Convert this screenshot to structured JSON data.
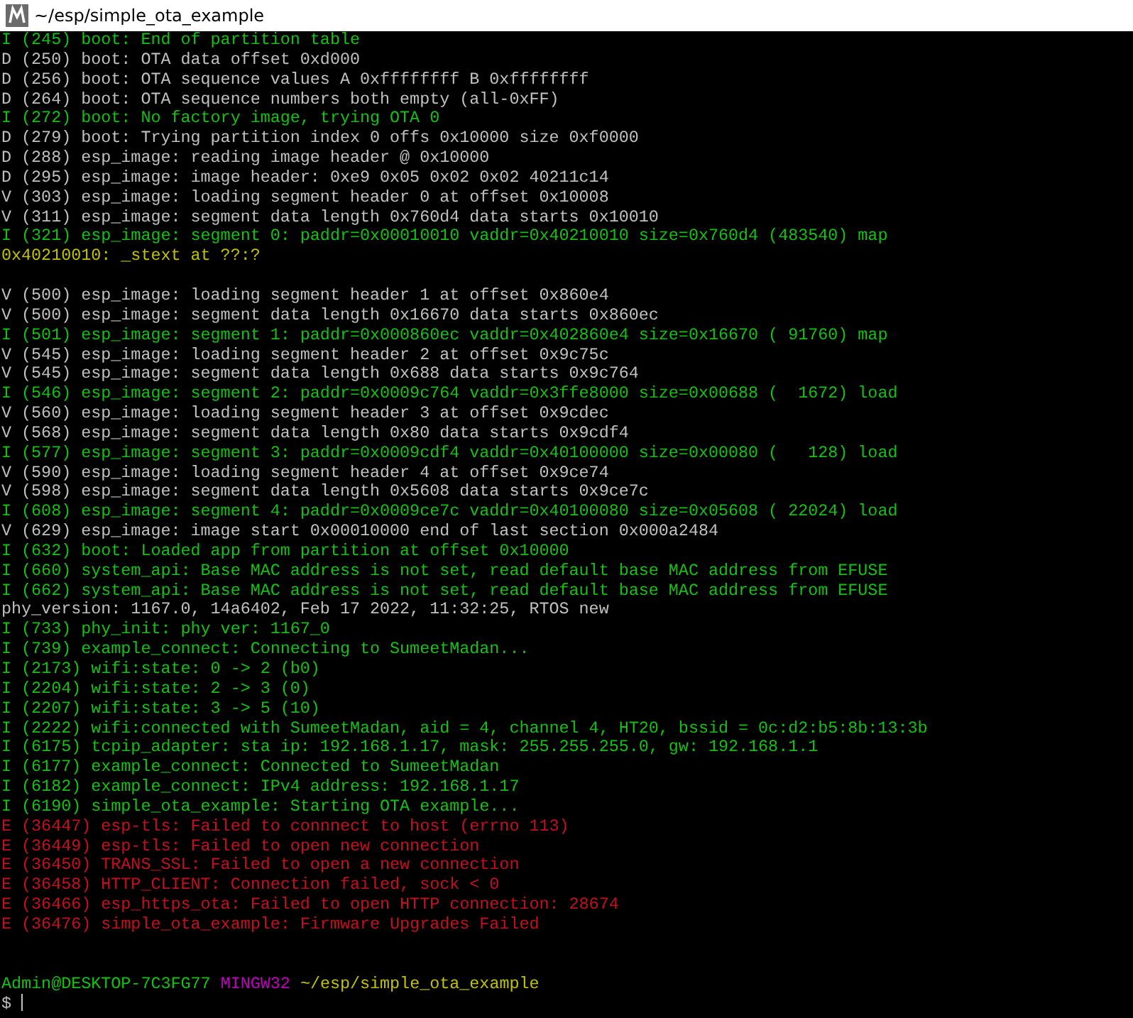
{
  "window": {
    "title": "~/esp/simple_ota_example"
  },
  "lines": [
    {
      "kind": "info",
      "text": "I (245) boot: End of partition table"
    },
    {
      "kind": "debug",
      "text": "D (250) boot: OTA data offset 0xd000"
    },
    {
      "kind": "debug",
      "text": "D (256) boot: OTA sequence values A 0xffffffff B 0xffffffff"
    },
    {
      "kind": "debug",
      "text": "D (264) boot: OTA sequence numbers both empty (all-0xFF)"
    },
    {
      "kind": "info",
      "text": "I (272) boot: No factory image, trying OTA 0"
    },
    {
      "kind": "debug",
      "text": "D (279) boot: Trying partition index 0 offs 0x10000 size 0xf0000"
    },
    {
      "kind": "debug",
      "text": "D (288) esp_image: reading image header @ 0x10000"
    },
    {
      "kind": "debug",
      "text": "D (295) esp_image: image header: 0xe9 0x05 0x02 0x02 40211c14"
    },
    {
      "kind": "verbose",
      "text": "V (303) esp_image: loading segment header 0 at offset 0x10008"
    },
    {
      "kind": "verbose",
      "text": "V (311) esp_image: segment data length 0x760d4 data starts 0x10010"
    },
    {
      "kind": "info",
      "text": "I (321) esp_image: segment 0: paddr=0x00010010 vaddr=0x40210010 size=0x760d4 (483540) map"
    },
    {
      "kind": "address",
      "text": "0x40210010: _stext at ??:?"
    },
    {
      "kind": "blank"
    },
    {
      "kind": "verbose",
      "text": "V (500) esp_image: loading segment header 1 at offset 0x860e4"
    },
    {
      "kind": "verbose",
      "text": "V (500) esp_image: segment data length 0x16670 data starts 0x860ec"
    },
    {
      "kind": "info",
      "text": "I (501) esp_image: segment 1: paddr=0x000860ec vaddr=0x402860e4 size=0x16670 ( 91760) map"
    },
    {
      "kind": "verbose",
      "text": "V (545) esp_image: loading segment header 2 at offset 0x9c75c"
    },
    {
      "kind": "verbose",
      "text": "V (545) esp_image: segment data length 0x688 data starts 0x9c764"
    },
    {
      "kind": "info",
      "text": "I (546) esp_image: segment 2: paddr=0x0009c764 vaddr=0x3ffe8000 size=0x00688 (  1672) load"
    },
    {
      "kind": "verbose",
      "text": "V (560) esp_image: loading segment header 3 at offset 0x9cdec"
    },
    {
      "kind": "verbose",
      "text": "V (568) esp_image: segment data length 0x80 data starts 0x9cdf4"
    },
    {
      "kind": "info",
      "text": "I (577) esp_image: segment 3: paddr=0x0009cdf4 vaddr=0x40100000 size=0x00080 (   128) load"
    },
    {
      "kind": "verbose",
      "text": "V (590) esp_image: loading segment header 4 at offset 0x9ce74"
    },
    {
      "kind": "verbose",
      "text": "V (598) esp_image: segment data length 0x5608 data starts 0x9ce7c"
    },
    {
      "kind": "info",
      "text": "I (608) esp_image: segment 4: paddr=0x0009ce7c vaddr=0x40100080 size=0x05608 ( 22024) load"
    },
    {
      "kind": "verbose",
      "text": "V (629) esp_image: image start 0x00010000 end of last section 0x000a2484"
    },
    {
      "kind": "info",
      "text": "I (632) boot: Loaded app from partition at offset 0x10000"
    },
    {
      "kind": "info",
      "text": "I (660) system_api: Base MAC address is not set, read default base MAC address from EFUSE"
    },
    {
      "kind": "info",
      "text": "I (662) system_api: Base MAC address is not set, read default base MAC address from EFUSE"
    },
    {
      "kind": "plain",
      "text": "phy_version: 1167.0, 14a6402, Feb 17 2022, 11:32:25, RTOS new"
    },
    {
      "kind": "info",
      "text": "I (733) phy_init: phy ver: 1167_0"
    },
    {
      "kind": "info",
      "text": "I (739) example_connect: Connecting to SumeetMadan..."
    },
    {
      "kind": "info",
      "text": "I (2173) wifi:state: 0 -> 2 (b0)"
    },
    {
      "kind": "info",
      "text": "I (2204) wifi:state: 2 -> 3 (0)"
    },
    {
      "kind": "info",
      "text": "I (2207) wifi:state: 3 -> 5 (10)"
    },
    {
      "kind": "info",
      "text": "I (2222) wifi:connected with SumeetMadan, aid = 4, channel 4, HT20, bssid = 0c:d2:b5:8b:13:3b"
    },
    {
      "kind": "info",
      "text": "I (6175) tcpip_adapter: sta ip: 192.168.1.17, mask: 255.255.255.0, gw: 192.168.1.1"
    },
    {
      "kind": "info",
      "text": "I (6177) example_connect: Connected to SumeetMadan"
    },
    {
      "kind": "info",
      "text": "I (6182) example_connect: IPv4 address: 192.168.1.17"
    },
    {
      "kind": "info",
      "text": "I (6190) simple_ota_example: Starting OTA example..."
    },
    {
      "kind": "error",
      "text": "E (36447) esp-tls: Failed to connnect to host (errno 113)"
    },
    {
      "kind": "error",
      "text": "E (36449) esp-tls: Failed to open new connection"
    },
    {
      "kind": "error",
      "text": "E (36450) TRANS_SSL: Failed to open a new connection"
    },
    {
      "kind": "error",
      "text": "E (36458) HTTP_CLIENT: Connection failed, sock < 0"
    },
    {
      "kind": "error",
      "text": "E (36466) esp_https_ota: Failed to open HTTP connection: 28674"
    },
    {
      "kind": "error",
      "text": "E (36476) simple_ota_example: Firmware Upgrades Failed"
    },
    {
      "kind": "blank"
    },
    {
      "kind": "blank"
    }
  ],
  "prompt": {
    "user_host": "Admin@DESKTOP-7C3FG77",
    "system": "MINGW32",
    "path": "~/esp/simple_ota_example",
    "symbol": "$"
  }
}
